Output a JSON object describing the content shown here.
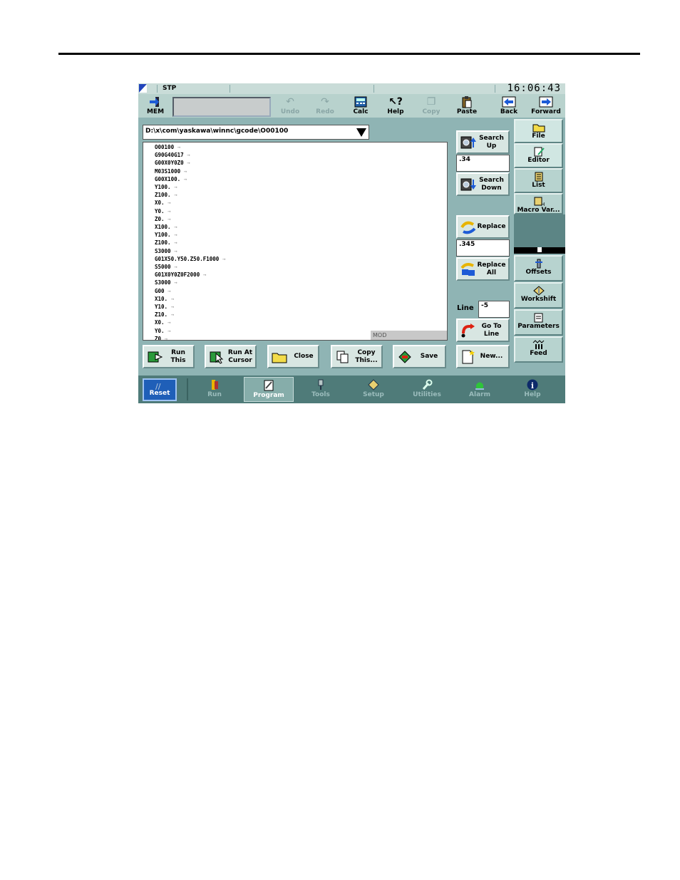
{
  "status": {
    "mode": "STP",
    "clock": "16:06:43"
  },
  "toolbar": {
    "mem": "MEM",
    "undo": "Undo",
    "redo": "Redo",
    "calc": "Calc",
    "help": "Help",
    "copy": "Copy",
    "paste": "Paste",
    "back": "Back",
    "forward": "Forward"
  },
  "editor": {
    "path": "D:\\x\\com\\yaskawa\\winnc\\gcode\\O00100",
    "mode_indicator": "MOD",
    "lines": [
      "O00100",
      "G90G40G17",
      "G00X0Y0Z0",
      "M03S1000",
      "G00X100.",
      "Y100.",
      "Z100.",
      "X0.",
      "Y0.",
      "Z0.",
      "X100.",
      "Y100.",
      "Z100.",
      "S3000",
      "G01X50.Y50.Z50.F1000",
      "S5000",
      "G01X0Y0Z0F2000",
      "S3000",
      "G00",
      "X10.",
      "Y10.",
      "Z10.",
      "X0.",
      "Y0.",
      "Z0"
    ]
  },
  "search": {
    "search_up": "Search\nUp",
    "search_value": ".34",
    "search_down": "Search\nDown",
    "replace": "Replace",
    "replace_value": ".345",
    "replace_all": "Replace\nAll",
    "line_label": "Line",
    "line_value": "-5",
    "go_to_line": "Go To\nLine",
    "new": "New..."
  },
  "bottom_buttons": {
    "run_this": "Run\nThis",
    "run_at_cursor": "Run At\nCursor",
    "close": "Close",
    "copy_this": "Copy\nThis...",
    "save": "Save"
  },
  "right_tabs": {
    "file": "File",
    "editor": "Editor",
    "list": "List",
    "macro_var": "Macro Var...",
    "offsets": "Offsets",
    "workshift": "Workshift",
    "parameters": "Parameters",
    "feed": "Feed"
  },
  "nav": {
    "reset": "Reset",
    "run": "Run",
    "program": "Program",
    "tools": "Tools",
    "setup": "Setup",
    "utilities": "Utilities",
    "alarm": "Alarm",
    "help": "Help"
  }
}
